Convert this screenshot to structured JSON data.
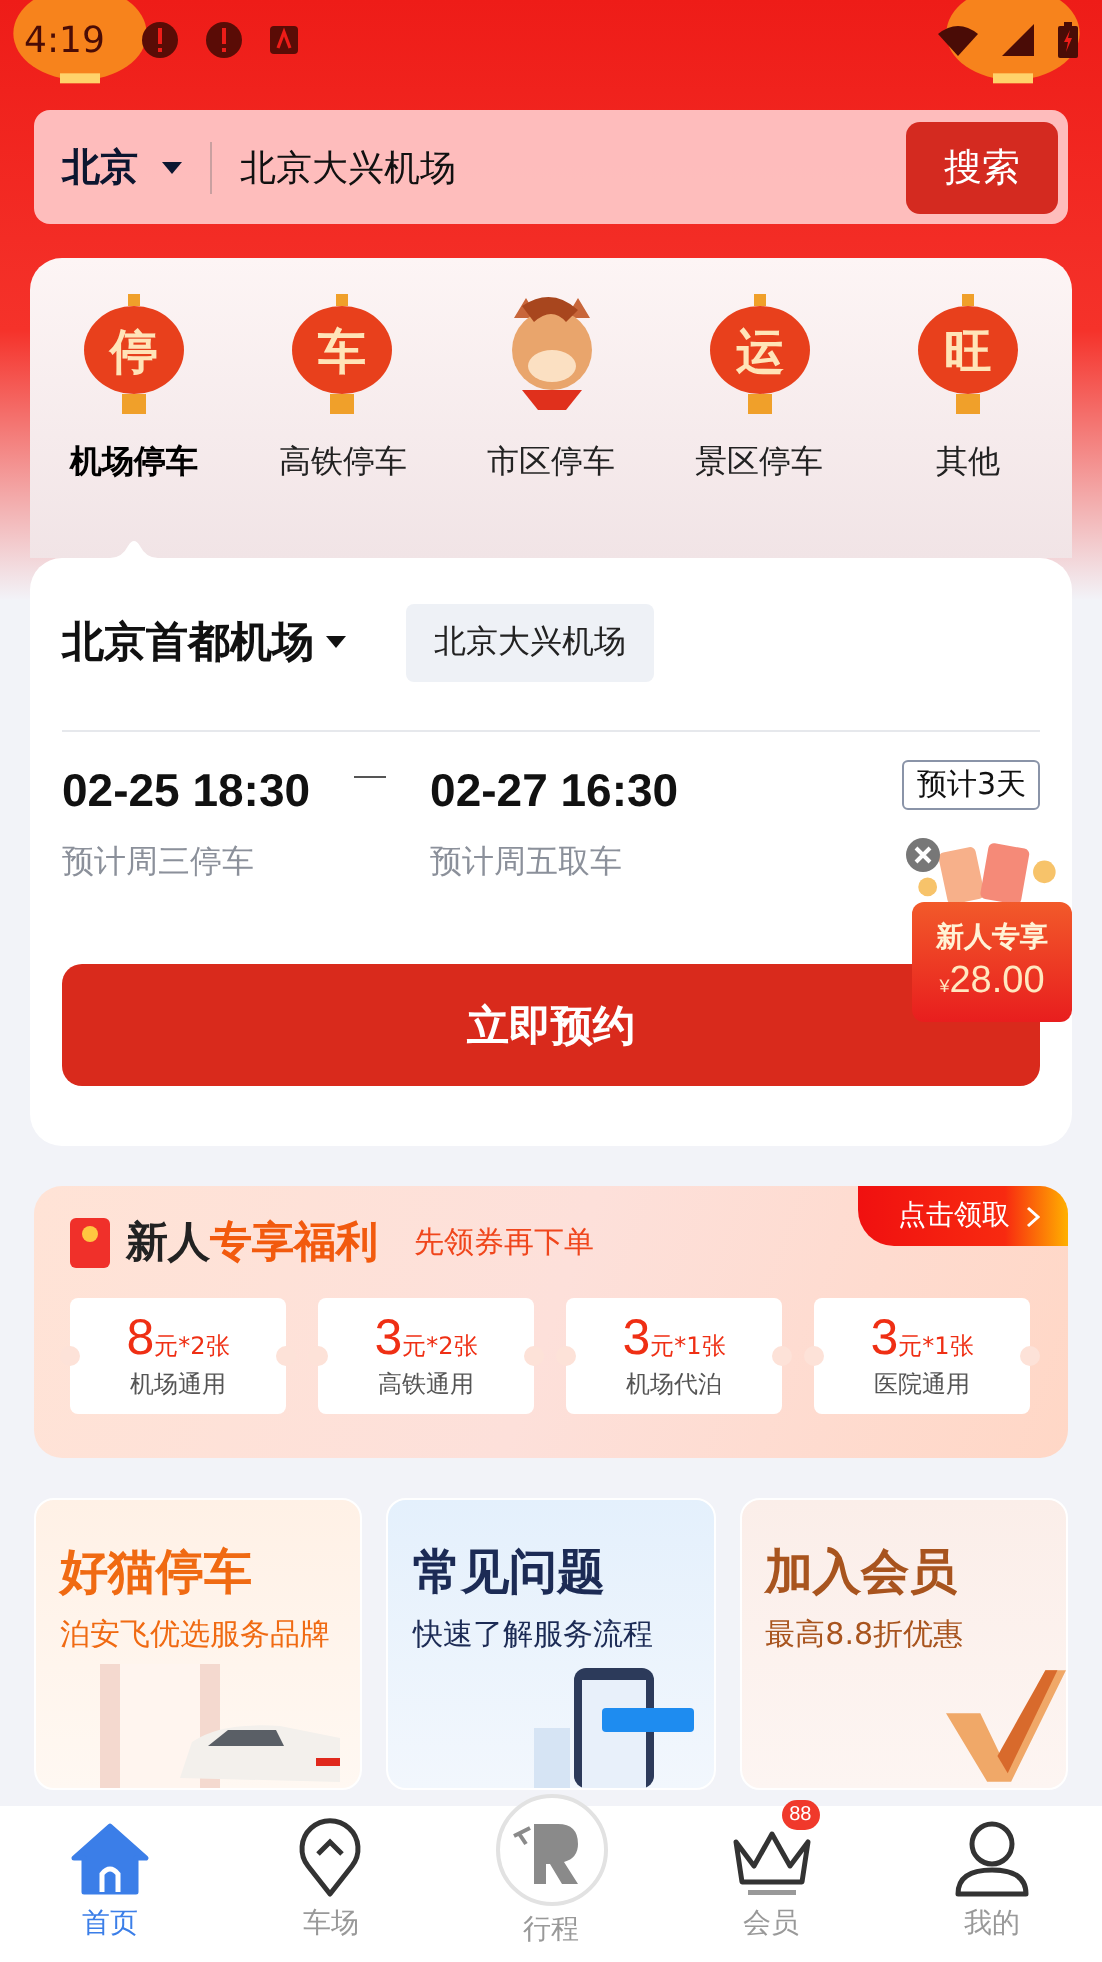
{
  "status_bar": {
    "time": "4:19"
  },
  "search": {
    "city": "北京",
    "value": "北京大兴机场",
    "button": "搜索"
  },
  "categories": [
    {
      "label": "机场停车",
      "kind": "lantern",
      "glyph": "停",
      "selected": true
    },
    {
      "label": "高铁停车",
      "kind": "lantern",
      "glyph": "车",
      "selected": false
    },
    {
      "label": "市区停车",
      "kind": "mascot",
      "selected": false
    },
    {
      "label": "景区停车",
      "kind": "lantern",
      "glyph": "运",
      "selected": false
    },
    {
      "label": "其他",
      "kind": "lantern",
      "glyph": "旺",
      "selected": false
    }
  ],
  "booking": {
    "airports": [
      {
        "label": "北京首都机场",
        "selected": true
      },
      {
        "label": "北京大兴机场",
        "selected": false
      }
    ],
    "start": {
      "datetime": "02-25 18:30",
      "note": "预计周三停车"
    },
    "end": {
      "datetime": "02-27 16:30",
      "note": "预计周五取车"
    },
    "duration": "预计3天",
    "button": "立即预约"
  },
  "floating_promo": {
    "title": "新人专享",
    "currency": "¥",
    "amount": "28.00"
  },
  "welfare": {
    "title": "新人",
    "title_highlight": "专享福利",
    "subtitle": "先领券再下单",
    "claim": "点击领取",
    "coupons": [
      {
        "amount": "8",
        "unit": "元*2张",
        "scope": "机场通用"
      },
      {
        "amount": "3",
        "unit": "元*2张",
        "scope": "高铁通用"
      },
      {
        "amount": "3",
        "unit": "元*1张",
        "scope": "机场代泊"
      },
      {
        "amount": "3",
        "unit": "元*1张",
        "scope": "医院通用"
      }
    ]
  },
  "features": [
    {
      "title": "好猫停车",
      "subtitle": "泊安飞优选服务品牌",
      "kind": "car",
      "color": "#f06a12"
    },
    {
      "title": "常见问题",
      "subtitle": "快速了解服务流程",
      "kind": "phone",
      "color": "#1c2b55"
    },
    {
      "title": "加入会员",
      "subtitle": "最高8.8折优惠",
      "kind": "vip",
      "color": "#a8541e"
    }
  ],
  "tab_bar": [
    {
      "label": "首页",
      "kind": "home",
      "selected": true
    },
    {
      "label": "车场",
      "kind": "pin",
      "selected": false
    },
    {
      "label": "行程",
      "kind": "logo",
      "selected": false
    },
    {
      "label": "会员",
      "kind": "crown",
      "selected": false,
      "badge": "88"
    },
    {
      "label": "我的",
      "kind": "person",
      "selected": false
    }
  ]
}
